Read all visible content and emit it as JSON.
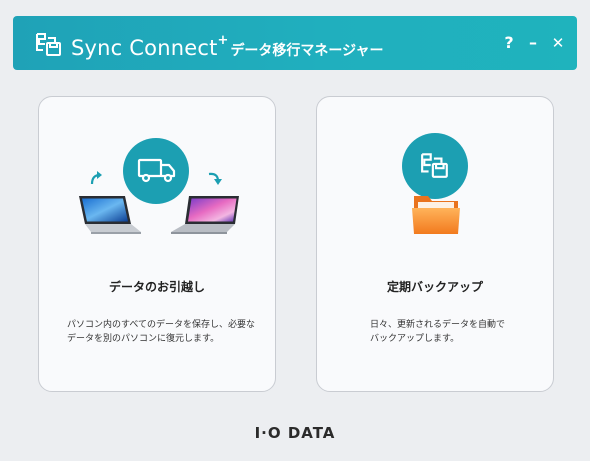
{
  "titlebar": {
    "brand": "Sync Connect",
    "brand_sup": "+",
    "subtitle": "データ移行マネージャー",
    "help_label": "?",
    "minimize_label": "–",
    "close_label": "✕"
  },
  "cards": [
    {
      "title": "データのお引越し",
      "description": "パソコン内のすべてのデータを保存し、必要なデータを別のパソコンに復元します。",
      "icon": "truck-icon"
    },
    {
      "title": "定期バックアップ",
      "description": "日々、更新されるデータを自動でバックアップします。",
      "icon": "app-logo-icon"
    }
  ],
  "footer": {
    "logo_text": "I·O DATA"
  },
  "colors": {
    "accent": "#1fa9ba",
    "circle": "#1c9fb2",
    "background": "#eceef1"
  }
}
